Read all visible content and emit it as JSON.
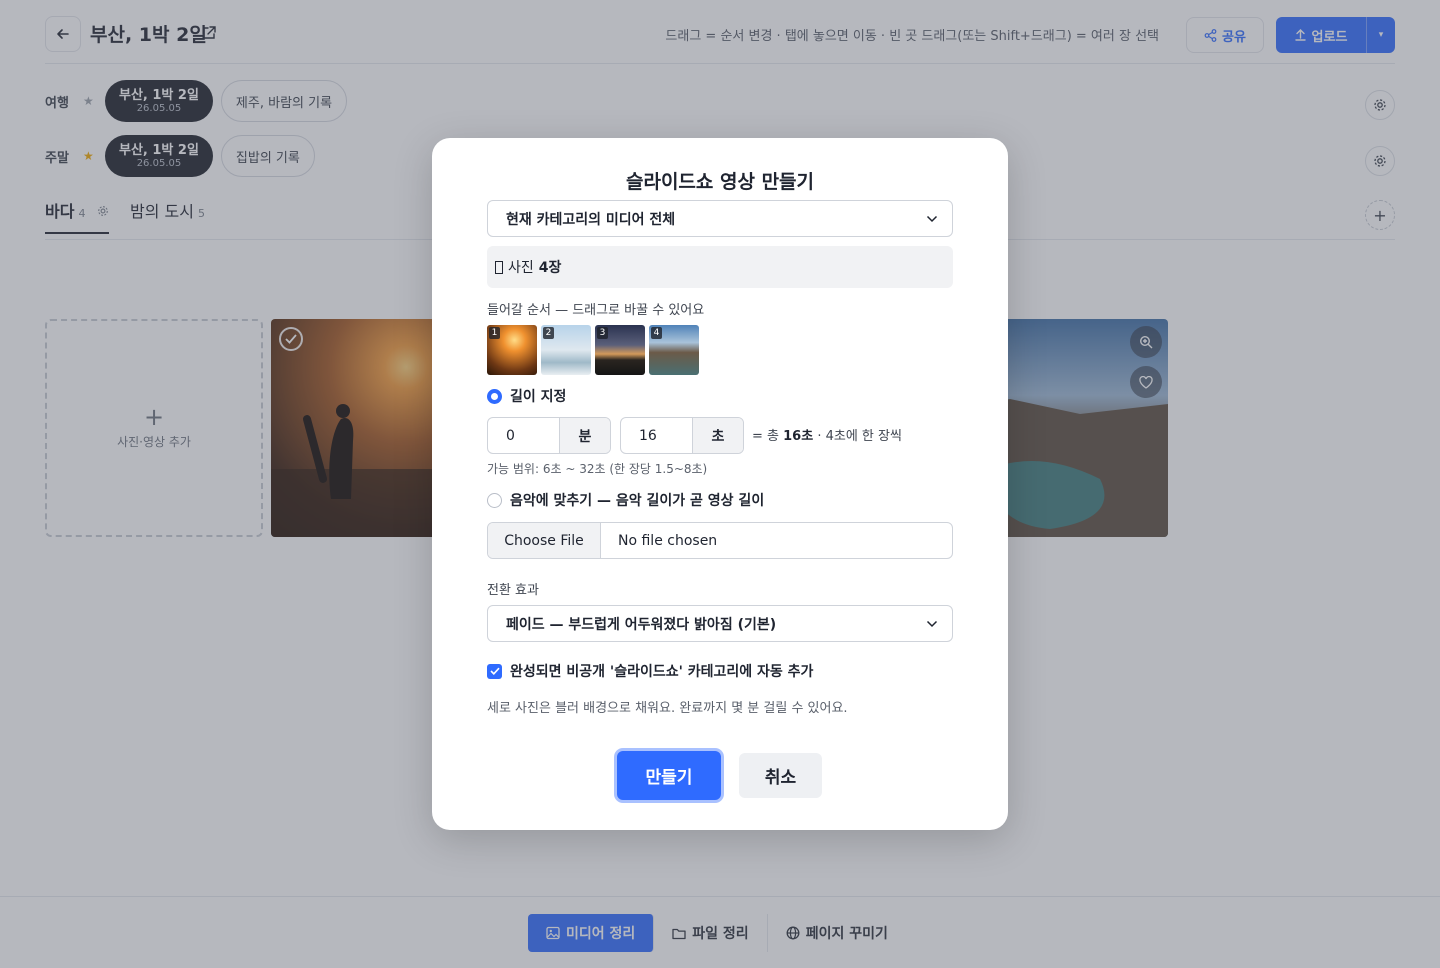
{
  "header": {
    "title": "부산, 1박 2일",
    "hint": "드래그 = 순서 변경 · 탭에 놓으면 이동 · 빈 곳 드래그(또는 Shift+드래그) = 여러 장 선택",
    "share_label": "공유",
    "upload_label": "업로드"
  },
  "groups": [
    {
      "label": "여행",
      "star_color": "#9aa0aa",
      "active_chip": {
        "title": "부산, 1박 2일",
        "date": "26.05.05"
      },
      "chip": "제주, 바람의 기록"
    },
    {
      "label": "주말",
      "star_color": "#f2a900",
      "active_chip": {
        "title": "부산, 1박 2일",
        "date": "26.05.05"
      },
      "chip": "집밥의 기록"
    }
  ],
  "tabs": [
    {
      "label": "바다",
      "count": "4",
      "active": true
    },
    {
      "label": "밤의 도시",
      "count": "5",
      "active": false
    }
  ],
  "gallery": {
    "add_label": "사진·영상 추가"
  },
  "bottom_nav": [
    {
      "label": "미디어 정리",
      "icon": "image-icon",
      "active": true
    },
    {
      "label": "파일 정리",
      "icon": "folder-icon",
      "active": false
    },
    {
      "label": "페이지 꾸미기",
      "icon": "globe-icon",
      "active": false
    }
  ],
  "modal": {
    "title": "슬라이드쇼 영상 만들기",
    "source_select": "현재 카테고리의 미디어 전체",
    "summary_prefix": "사진",
    "summary_count": "4장",
    "order_label": "들어갈 순서 — 드래그로 바꿀 수 있어요",
    "thumbs": [
      "1",
      "2",
      "3",
      "4"
    ],
    "length_option": "길이 지정",
    "minutes_value": "0",
    "minutes_unit": "분",
    "seconds_value": "16",
    "seconds_unit": "초",
    "total_prefix": "= 총",
    "total_value": "16초",
    "total_suffix": "· 4초에 한 장씩",
    "range_hint": "가능 범위: 6초 ~ 32초 (한 장당 1.5~8초)",
    "music_option": "음악에 맞추기 — 음악 길이가 곧 영상 길이",
    "file_button": "Choose File",
    "file_status": "No file chosen",
    "transition_label": "전환 효과",
    "transition_select": "페이드 — 부드럽게 어두워졌다 밝아짐 (기본)",
    "auto_add_label": "완성되면 비공개 '슬라이드쇼' 카테고리에 자동 추가",
    "note": "세로 사진은 블러 배경으로 채워요. 완료까지 몇 분 걸릴 수 있어요.",
    "create_button": "만들기",
    "cancel_button": "취소"
  },
  "colors": {
    "accent": "#2f6bff",
    "dark_chip": "#1c2029",
    "overlay": "rgba(80,86,100,0.42)"
  }
}
